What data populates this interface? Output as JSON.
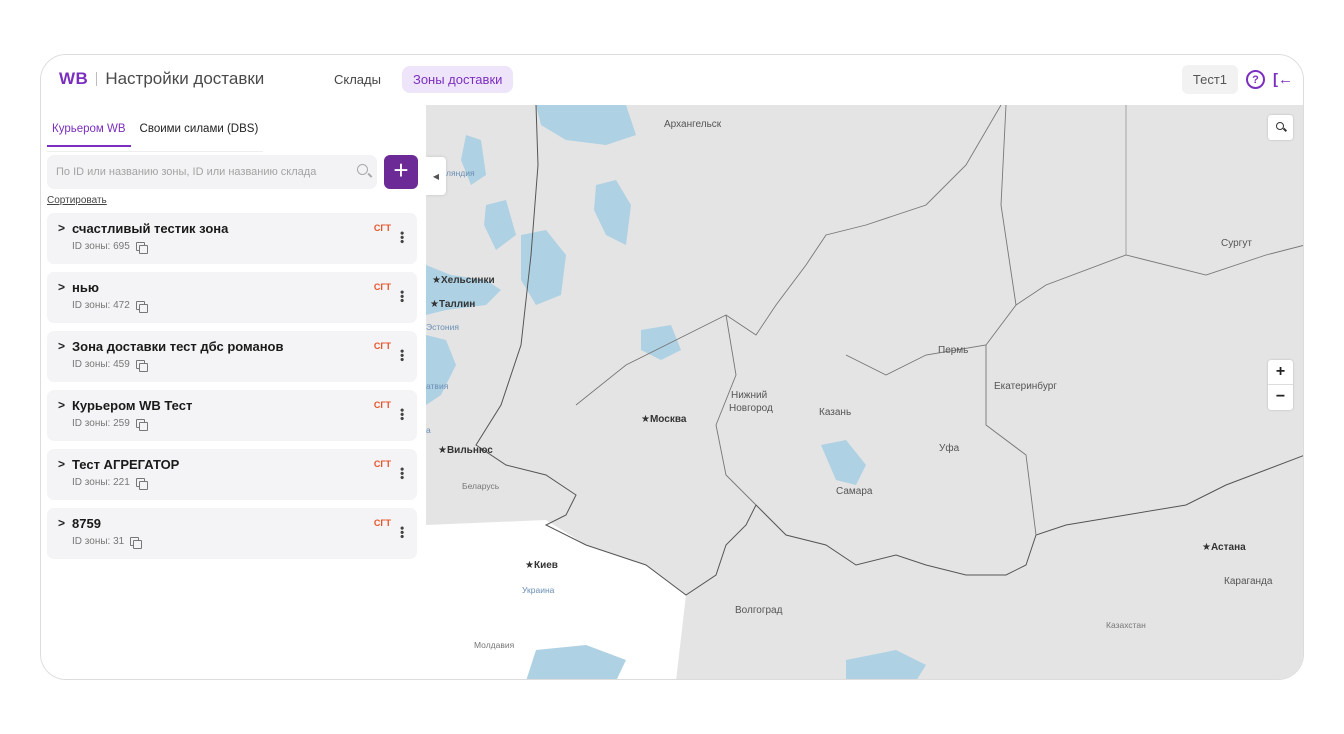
{
  "header": {
    "logo": "WB",
    "title": "Настройки доставки",
    "nav": [
      {
        "label": "Склады",
        "active": false
      },
      {
        "label": "Зоны доставки",
        "active": true
      }
    ],
    "user": "Тест1",
    "help_icon": "question-circle-icon",
    "logout_icon": "logout-arrow-icon"
  },
  "sidebar": {
    "tabs": [
      {
        "label": "Курьером WB",
        "active": true
      },
      {
        "label": "Своими силами (DBS)",
        "active": false
      }
    ],
    "search": {
      "placeholder": "По ID или названию зоны, ID или названию склада",
      "value": ""
    },
    "add_button": "+",
    "sort_label": "Сортировать",
    "zones": [
      {
        "name": "счастливый тестик зона",
        "id_label": "ID зоны: 695",
        "badge": "СГТ"
      },
      {
        "name": "нью",
        "id_label": "ID зоны: 472",
        "badge": "СГТ"
      },
      {
        "name": "Зона доставки тест дбс романов",
        "id_label": "ID зоны: 459",
        "badge": "СГТ"
      },
      {
        "name": "Курьером WB Тест",
        "id_label": "ID зоны: 259",
        "badge": "СГТ"
      },
      {
        "name": "Тест АГРЕГАТОР",
        "id_label": "ID зоны: 221",
        "badge": "СГТ"
      },
      {
        "name": "8759",
        "id_label": "ID зоны: 31",
        "badge": "СГТ"
      }
    ]
  },
  "map": {
    "zoom_in": "+",
    "zoom_out": "−",
    "labels": {
      "arkhangelsk": "Архангельск",
      "surgut": "Сургут",
      "finland": "ляндия",
      "helsinki": "★Хельсинки",
      "tallinn": "★Таллин",
      "estonia": "Эстония",
      "latvia": "атвия",
      "perm": "Пермь",
      "yekaterinburg": "Екатеринбург",
      "nizhny1": "Нижний",
      "nizhny2": "Новгород",
      "moscow": "★Москва",
      "kazan": "Казань",
      "vilnius": "★Вильнюс",
      "ufa": "Уфа",
      "belarus": "Беларусь",
      "samara": "Самара",
      "kiev": "★Киев",
      "ukraine": "Украина",
      "astana": "★Астана",
      "karaganda": "Караганда",
      "volgograd": "Волгоград",
      "kazakhstan": "Казахстан",
      "moldova": "Молдавия",
      "a_letter": "а"
    }
  },
  "colors": {
    "accent": "#7b2fbf",
    "add_button": "#6c2a96",
    "badge": "#e8542a",
    "land_russia": "#e4e4e5",
    "land_other": "#ffffff",
    "water": "#aed1e3"
  }
}
